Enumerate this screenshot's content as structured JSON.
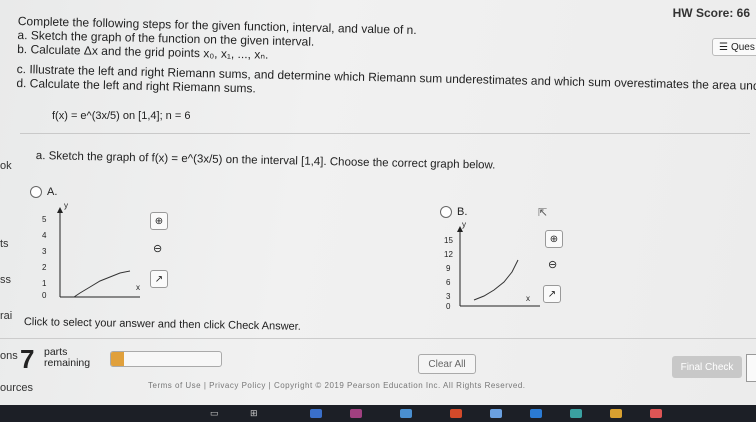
{
  "header": {
    "hw_score": "HW Score: 66",
    "ques_label": "Ques"
  },
  "sidebar_fragments": [
    "ok",
    "ts",
    "ss",
    "rai",
    "ons",
    "ources"
  ],
  "instructions": {
    "intro": "Complete the following steps for the given function, interval, and value of n.",
    "a": "a. Sketch the graph of the function on the given interval.",
    "b": "b. Calculate Δx and the grid points x₀, x₁, ..., xₙ.",
    "c": "c. Illustrate the left and right Riemann sums, and determine which Riemann sum underestimates and which sum overestimates the area under the curve.",
    "d": "d. Calculate the left and right Riemann sums."
  },
  "function_text": "f(x) = e^(3x/5) on [1,4]; n = 6",
  "question": {
    "text": "a. Sketch the graph of f(x) = e^(3x/5) on the interval [1,4]. Choose the correct graph below."
  },
  "options": [
    {
      "label": "A.",
      "y_ticks": [
        "5",
        "4",
        "3",
        "2",
        "1",
        "0"
      ],
      "x_axis": "x",
      "y_axis": "y"
    },
    {
      "label": "B.",
      "y_ticks": [
        "15",
        "12",
        "9",
        "6",
        "3",
        "0"
      ],
      "x_axis": "x",
      "y_axis": "y"
    }
  ],
  "graph_icons": [
    "zoom-in-icon",
    "zoom-out-icon",
    "external-link-icon"
  ],
  "instruction_bottom": "Click to select your answer and then click Check Answer.",
  "parts": {
    "count": "7",
    "label_line1": "parts",
    "label_line2": "remaining",
    "progress_fraction": 0.12
  },
  "buttons": {
    "clear_all": "Clear All",
    "final_check": "Final Check"
  },
  "footer": "Terms of Use | Privacy Policy | Copyright © 2019 Pearson Education Inc. All Rights Reserved.",
  "colors": {
    "progress": "#e0a03c",
    "taskbar": "#1c1f26"
  }
}
